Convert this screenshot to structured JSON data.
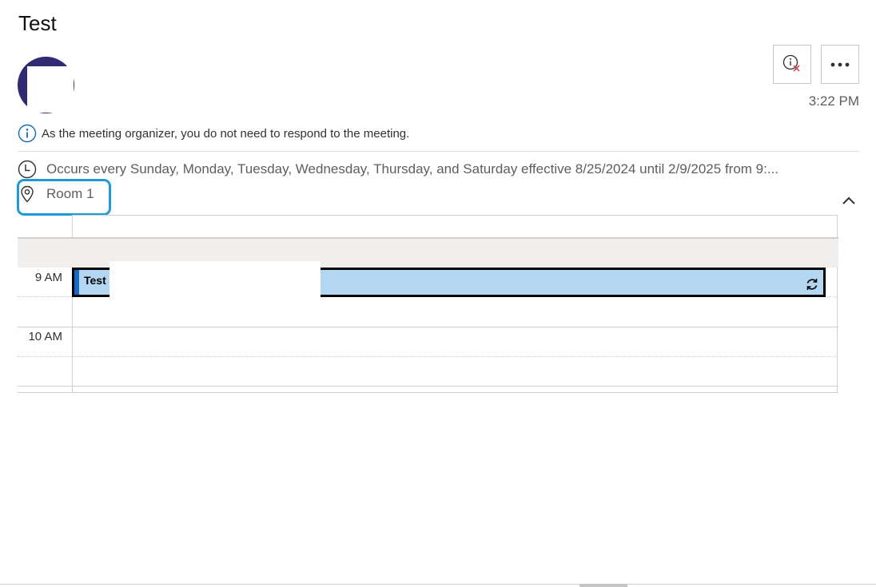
{
  "message": {
    "title": "Test",
    "received_time": "3:22 PM"
  },
  "actions": {
    "info_icon": "info-with-x-icon",
    "more_icon": "ellipsis-icon"
  },
  "notice": {
    "text": "As the meeting organizer, you do not need to respond to the meeting."
  },
  "details": {
    "occurs": "Occurs every Sunday, Monday, Tuesday, Wednesday, Thursday, and Saturday effective 8/25/2024 until 2/9/2025 from 9:...",
    "location": "Room 1"
  },
  "calendar": {
    "hours": [
      "9 AM",
      "10 AM"
    ],
    "event": {
      "title": "Test",
      "recurring": true
    }
  },
  "colors": {
    "accent_blue": "#1569c7",
    "event_fill": "#b3d7f2",
    "highlight": "#1e9bd7",
    "avatar": "#2f2a72"
  }
}
